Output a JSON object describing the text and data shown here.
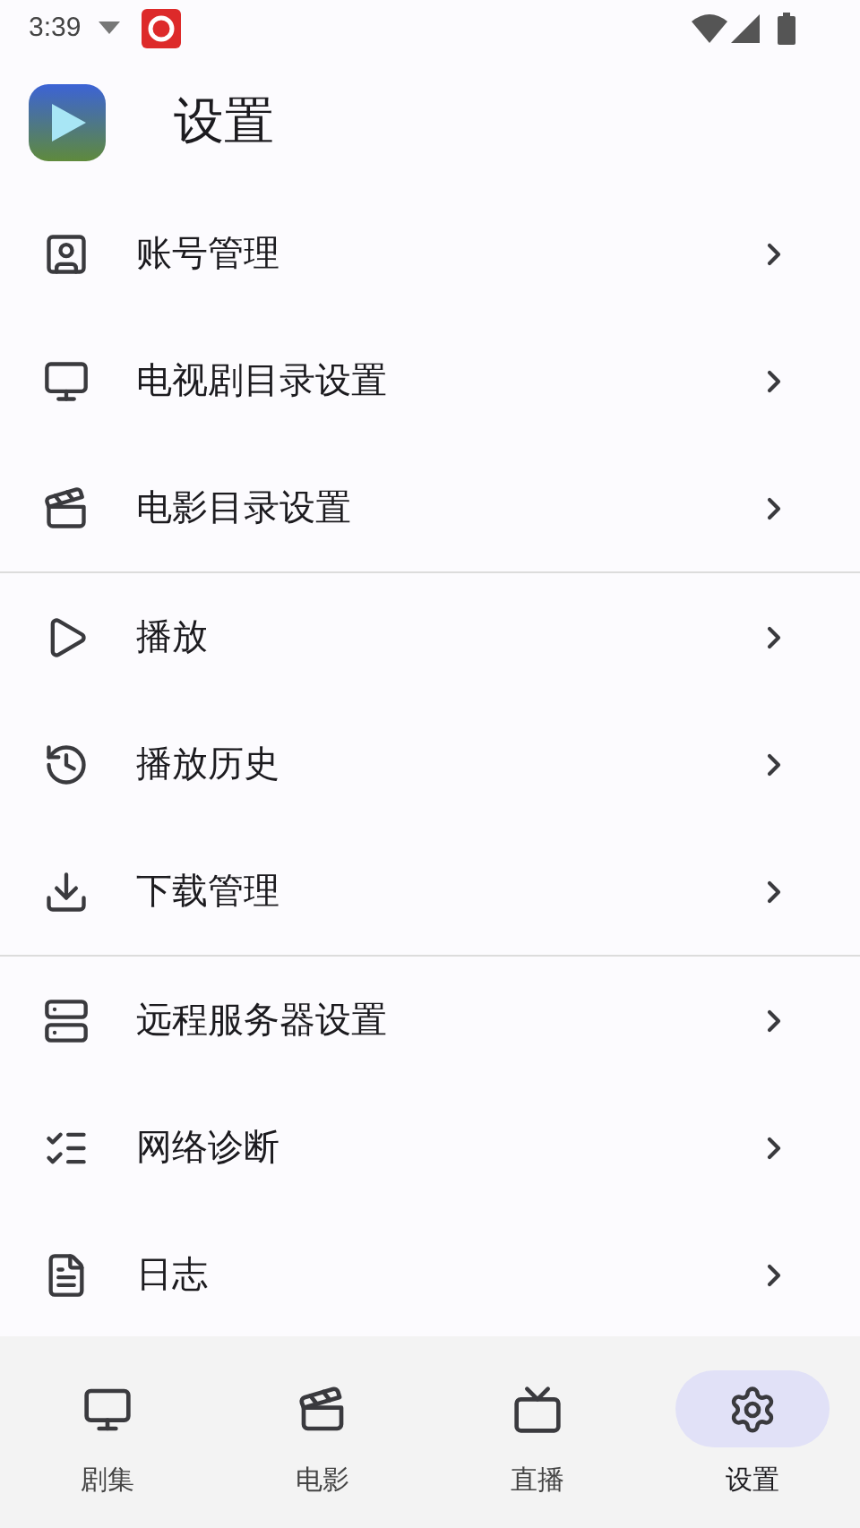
{
  "status_bar": {
    "time": "3:39"
  },
  "header": {
    "title": "设置"
  },
  "sections": [
    {
      "items": [
        {
          "kind": "account",
          "label": "账号管理"
        },
        {
          "kind": "tv",
          "label": "电视剧目录设置"
        },
        {
          "kind": "movie",
          "label": "电影目录设置"
        }
      ]
    },
    {
      "items": [
        {
          "kind": "play",
          "label": "播放"
        },
        {
          "kind": "history",
          "label": "播放历史"
        },
        {
          "kind": "download",
          "label": "下载管理"
        }
      ]
    },
    {
      "items": [
        {
          "kind": "server",
          "label": "远程服务器设置"
        },
        {
          "kind": "network",
          "label": "网络诊断"
        },
        {
          "kind": "log",
          "label": "日志"
        }
      ]
    }
  ],
  "bottom_nav": [
    {
      "kind": "tv",
      "label": "剧集",
      "selected": false
    },
    {
      "kind": "movie",
      "label": "电影",
      "selected": false
    },
    {
      "kind": "live",
      "label": "直播",
      "selected": false
    },
    {
      "kind": "settings",
      "label": "设置",
      "selected": true
    }
  ]
}
